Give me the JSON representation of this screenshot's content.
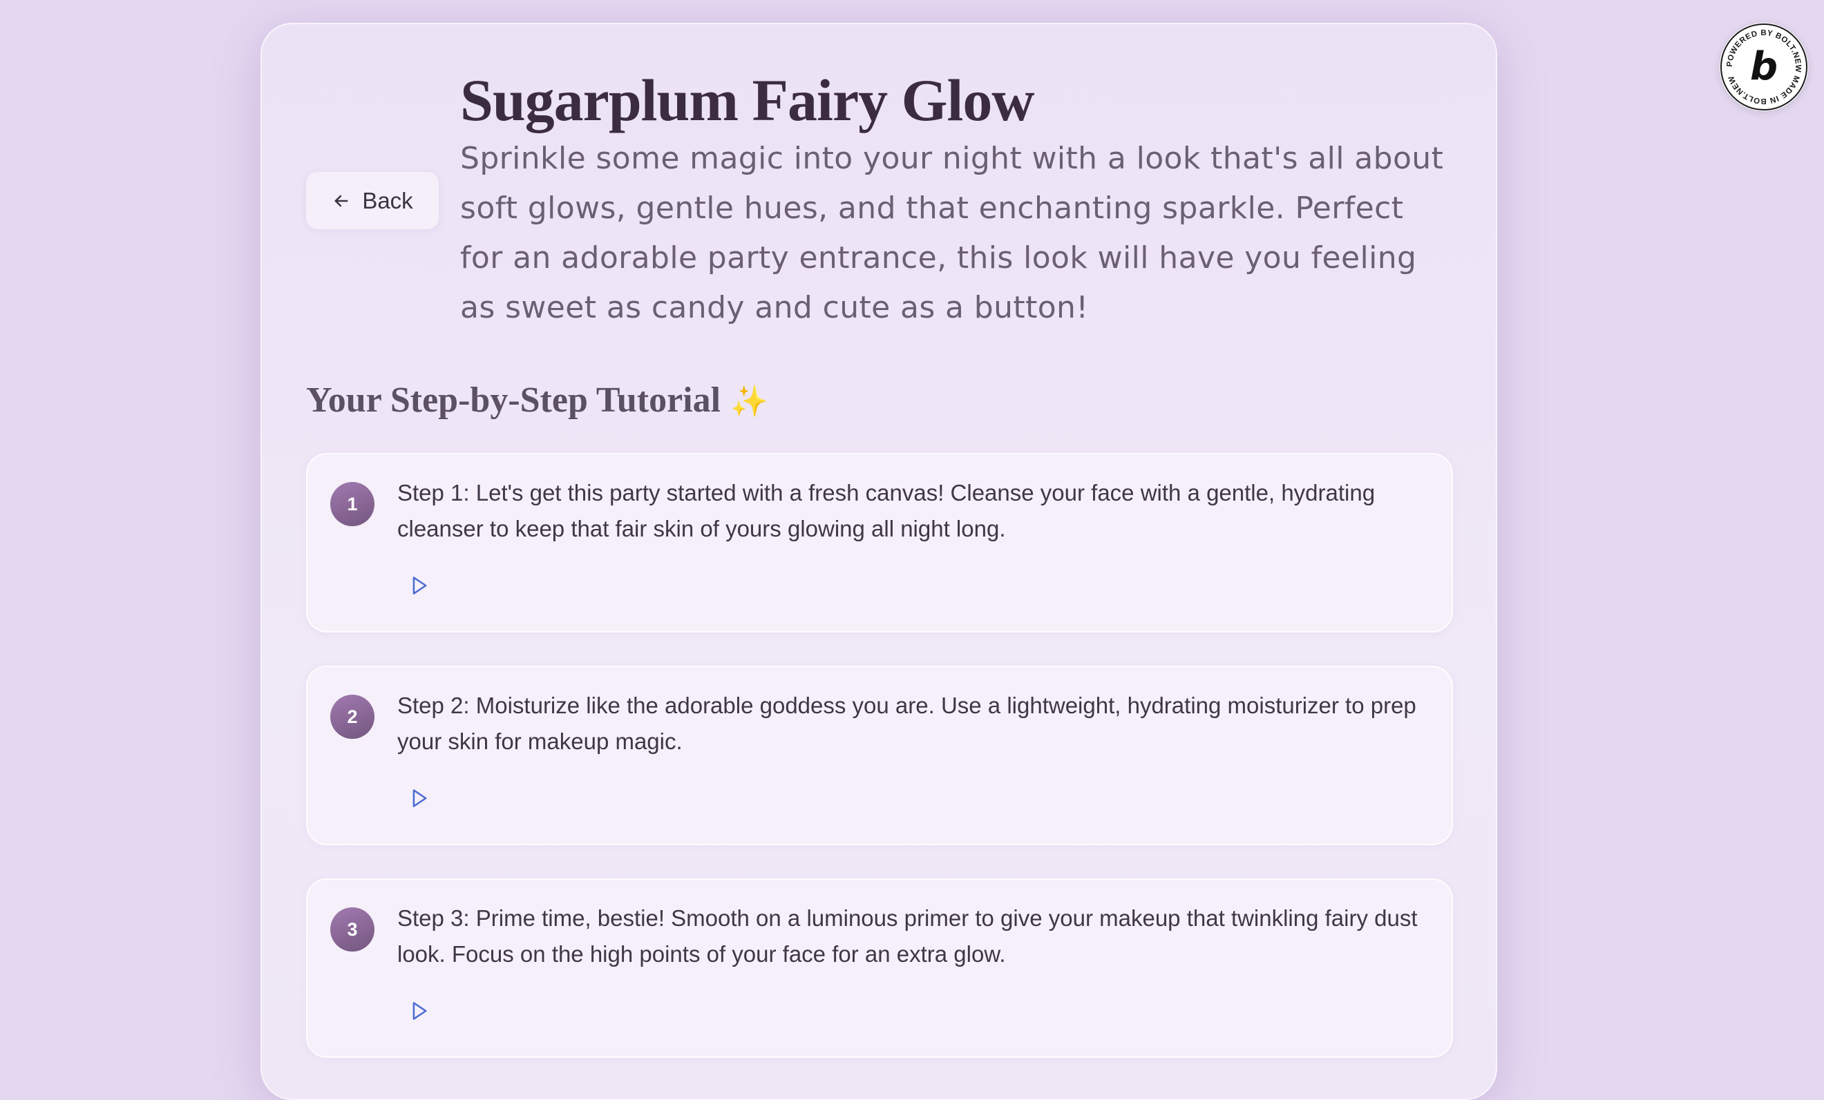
{
  "back_button": {
    "label": "Back"
  },
  "page": {
    "title": "Sugarplum Fairy Glow",
    "intro": "Sprinkle some magic into your night with a look that's all about soft glows, gentle hues, and that enchanting sparkle. Perfect for an adorable party entrance, this look will have you feeling as sweet as candy and cute as a button!"
  },
  "tutorial": {
    "heading": "Your Step-by-Step Tutorial",
    "heading_emoji": "✨",
    "steps": [
      {
        "number": "1",
        "text": "Step 1: Let's get this party started with a fresh canvas! Cleanse your face with a gentle, hydrating cleanser to keep that fair skin of yours glowing all night long.",
        "play_icon": "play-icon"
      },
      {
        "number": "2",
        "text": "Step 2: Moisturize like the adorable goddess you are. Use a lightweight, hydrating moisturizer to prep your skin for makeup magic.",
        "play_icon": "play-icon"
      },
      {
        "number": "3",
        "text": "Step 3: Prime time, bestie! Smooth on a luminous primer to give your makeup that twinkling fairy dust look. Focus on the high points of your face for an extra glow.",
        "play_icon": "play-icon"
      }
    ]
  },
  "badge": {
    "letter": "b",
    "ring_text": "POWERED BY BOLT.NEW MADE IN BOLT.NEW"
  },
  "colors": {
    "background": "#e4d8f0",
    "card": "#efe7f6",
    "title": "#3b2c3f",
    "step_number_gradient_start": "#a17ab0",
    "step_number_gradient_end": "#74567f",
    "play_icon": "#4d6bd1",
    "sparkle": "#e9c55a"
  }
}
